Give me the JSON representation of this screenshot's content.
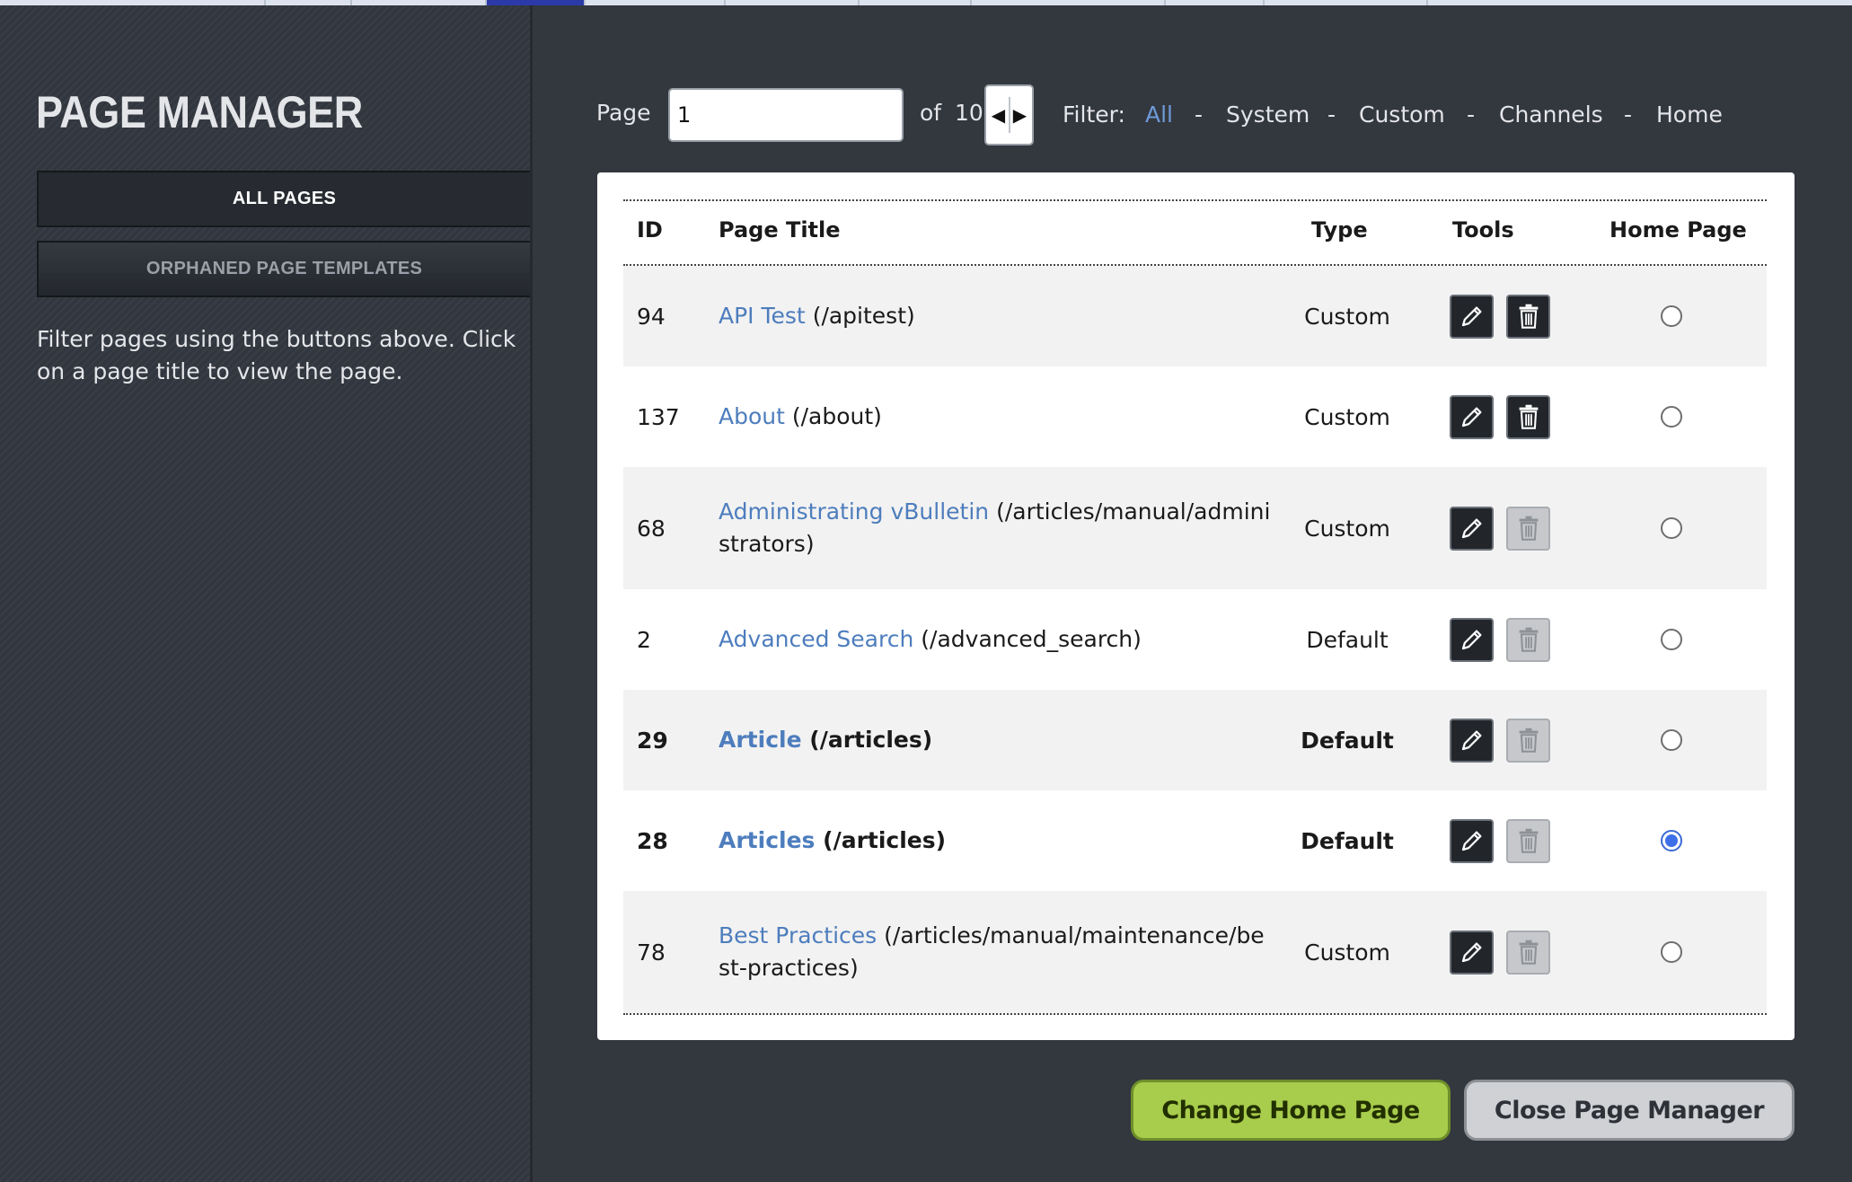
{
  "sidebar": {
    "title": "PAGE MANAGER",
    "buttons": {
      "all_pages": "ALL PAGES",
      "orphaned": "ORPHANED PAGE TEMPLATES"
    },
    "help_text": "Filter pages using the buttons above. Click on a page title to view the page."
  },
  "pager": {
    "page_label": "Page",
    "page_value": "1",
    "of_label": "of",
    "total_pages": "10",
    "prev_glyph": "◀",
    "next_glyph": "▶",
    "filter_label": "Filter:",
    "separator": "-",
    "filters": [
      "All",
      "System",
      "Custom",
      "Channels",
      "Home"
    ],
    "active_filter": "All"
  },
  "table": {
    "headers": {
      "id": "ID",
      "title": "Page Title",
      "type": "Type",
      "tools": "Tools",
      "home": "Home Page"
    },
    "rows": [
      {
        "id": "94",
        "title": "API Test",
        "path": "(/apitest)",
        "type": "Custom",
        "delete_enabled": true,
        "home": false,
        "bold": false
      },
      {
        "id": "137",
        "title": "About",
        "path": "(/about)",
        "type": "Custom",
        "delete_enabled": true,
        "home": false,
        "bold": false
      },
      {
        "id": "68",
        "title": "Administrating vBulletin",
        "path": "(/articles/manual/administrators)",
        "type": "Custom",
        "delete_enabled": false,
        "home": false,
        "bold": false
      },
      {
        "id": "2",
        "title": "Advanced Search",
        "path": "(/advanced_search)",
        "type": "Default",
        "delete_enabled": false,
        "home": false,
        "bold": false
      },
      {
        "id": "29",
        "title": "Article",
        "path": "(/articles)",
        "type": "Default",
        "delete_enabled": false,
        "home": false,
        "bold": true
      },
      {
        "id": "28",
        "title": "Articles",
        "path": "(/articles)",
        "type": "Default",
        "delete_enabled": false,
        "home": true,
        "bold": true
      },
      {
        "id": "78",
        "title": "Best Practices",
        "path": "(/articles/manual/maintenance/best-practices)",
        "type": "Custom",
        "delete_enabled": false,
        "home": false,
        "bold": false
      }
    ]
  },
  "actions": {
    "change_home": "Change Home Page",
    "close": "Close Page Manager"
  },
  "colors": {
    "link": "#4d7dbd",
    "active_filter": "#6e9ad8",
    "change_button": "#a8cc4c",
    "radio_checked": "#3d6fe8"
  },
  "icons": {
    "edit": "pencil-icon",
    "delete": "trash-icon"
  }
}
